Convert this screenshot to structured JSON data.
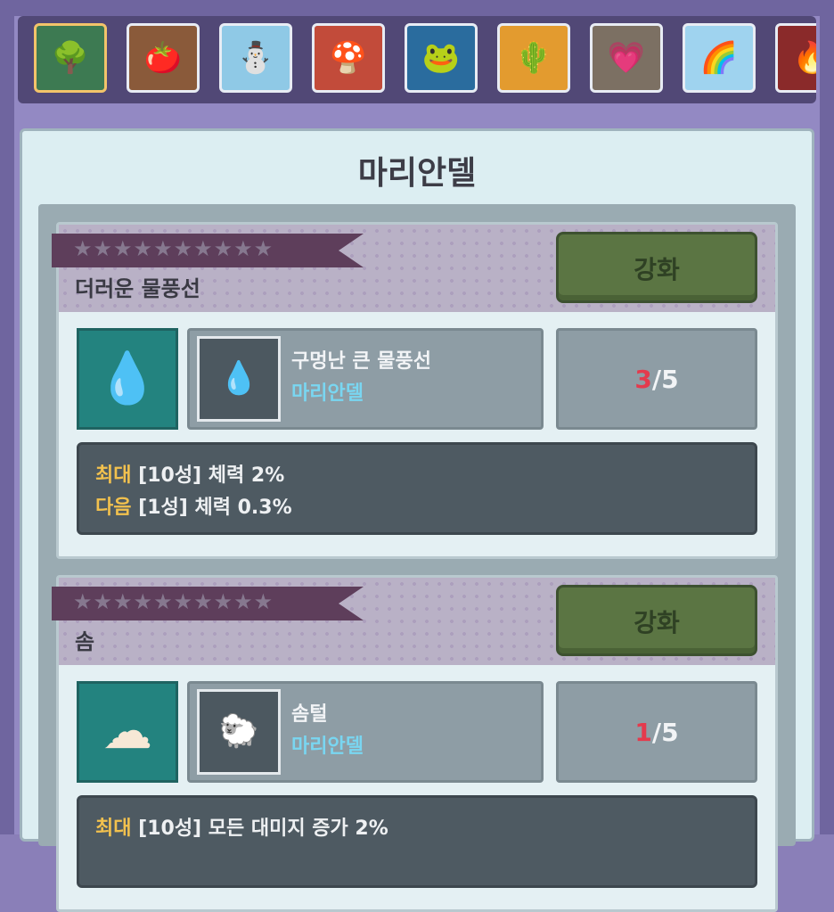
{
  "regions": [
    {
      "name": "forest",
      "icon": "🌳",
      "bg": "#3d7a52",
      "selected": true
    },
    {
      "name": "mushroom-farm",
      "icon": "🍅",
      "bg": "#8a5a3a",
      "selected": false
    },
    {
      "name": "snowfield",
      "icon": "⛄",
      "bg": "#8fc9e6",
      "selected": false
    },
    {
      "name": "mushroom",
      "icon": "🍄",
      "bg": "#c24b3a",
      "selected": false
    },
    {
      "name": "water",
      "icon": "🐸",
      "bg": "#2a6c9e",
      "selected": false
    },
    {
      "name": "desert",
      "icon": "🌵",
      "bg": "#e39b2f",
      "selected": false
    },
    {
      "name": "cave",
      "icon": "💗",
      "bg": "#7c7063",
      "selected": false
    },
    {
      "name": "rainbow",
      "icon": "🌈",
      "bg": "#9fd3ef",
      "selected": false
    },
    {
      "name": "lava",
      "icon": "🔥",
      "bg": "#8a2a2a",
      "selected": false
    }
  ],
  "panel": {
    "title": "마리안델"
  },
  "upgrade_label": "강화",
  "star_count": 10,
  "cards": [
    {
      "name": "더러운 물풍선",
      "stars": "★★★★★★★★★★",
      "item_icon": "water-balloon-icon",
      "item_glyph": "💧",
      "material": {
        "name": "구멍난 큰 물풍선",
        "source": "마리안델",
        "icon": "small-water-balloon-icon",
        "glyph": "💧"
      },
      "count": {
        "current": "3",
        "total": "/5"
      },
      "stats": [
        {
          "key": "최대",
          "text": " [10성] 체력 2%"
        },
        {
          "key": "다음",
          "text": " [1성] 체력 0.3%"
        }
      ]
    },
    {
      "name": "솜",
      "stars": "★★★★★★★★★★",
      "item_icon": "cotton-icon",
      "item_glyph": "☁",
      "material": {
        "name": "솜털",
        "source": "마리안델",
        "icon": "fluff-icon",
        "glyph": "🐑"
      },
      "count": {
        "current": "1",
        "total": "/5"
      },
      "stats": [
        {
          "key": "최대",
          "text": " [10성] 모든 대미지 증가 2%"
        }
      ]
    }
  ]
}
